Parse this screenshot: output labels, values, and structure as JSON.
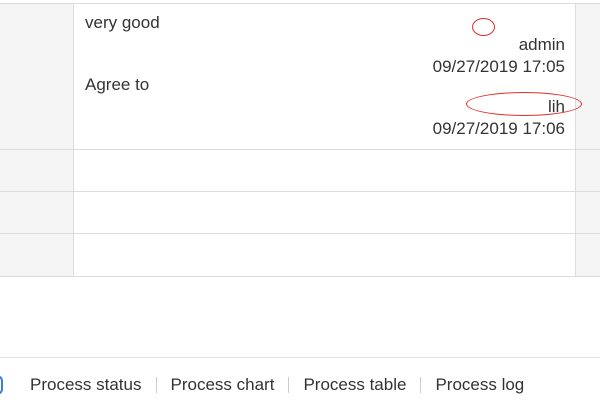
{
  "comments": [
    {
      "text": "very good",
      "user": "admin",
      "time": "09/27/2019 17:05"
    },
    {
      "text": "Agree to",
      "user": "lih",
      "time": "09/27/2019 17:06"
    }
  ],
  "tabs": [
    {
      "label": "Process status"
    },
    {
      "label": "Process chart"
    },
    {
      "label": "Process table"
    },
    {
      "label": "Process log"
    }
  ],
  "colors": {
    "annotation": "#e03030",
    "accent": "#3b7dd8",
    "border": "#dcdcdc",
    "label_bg": "#f5f5f5"
  }
}
